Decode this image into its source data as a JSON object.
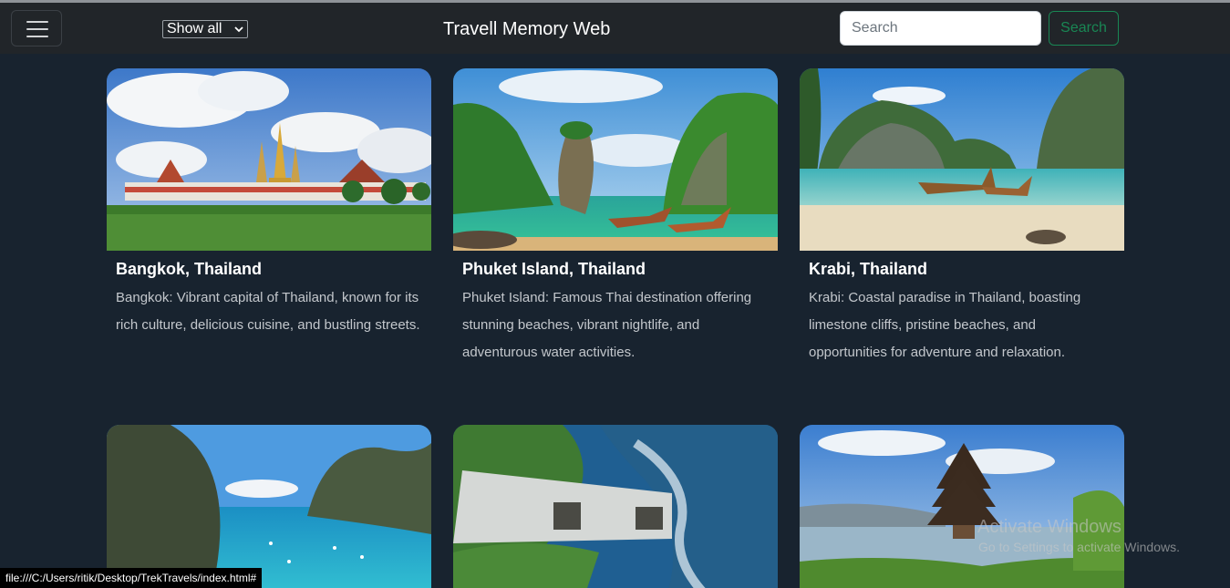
{
  "header": {
    "menu_icon": "hamburger-icon",
    "filter": {
      "selected": "Show all"
    },
    "brand": "Travell Memory Web",
    "search": {
      "placeholder": "Search",
      "button_label": "Search"
    }
  },
  "cards": [
    {
      "title": "Bangkok, Thailand",
      "text": "Bangkok: Vibrant capital of Thailand, known for its rich culture, delicious cuisine, and bustling streets.",
      "image": "bangkok-temple-image"
    },
    {
      "title": "Phuket Island, Thailand",
      "text": "Phuket Island: Famous Thai destination offering stunning beaches, vibrant nightlife, and adventurous water activities.",
      "image": "phuket-island-image"
    },
    {
      "title": "Krabi, Thailand",
      "text": "Krabi: Coastal paradise in Thailand, boasting limestone cliffs, pristine beaches, and opportunities for adventure and relaxation.",
      "image": "krabi-beach-image"
    },
    {
      "image": "bay-cliffs-image"
    },
    {
      "image": "aerial-coast-image"
    },
    {
      "image": "bali-temple-image"
    }
  ],
  "status_bar": {
    "url": "file:///C:/Users/ritik/Desktop/TrekTravels/index.html#"
  },
  "watermark": {
    "line1": "Activate Windows",
    "line2": "Go to Settings to activate Windows."
  },
  "colors": {
    "background": "#18232f",
    "navbar": "#212529",
    "accent": "#198754"
  }
}
